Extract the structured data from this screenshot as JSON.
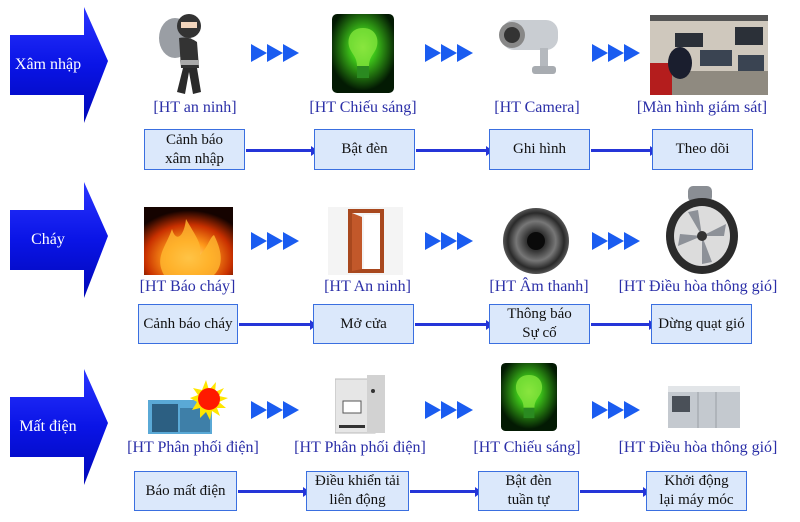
{
  "colors": {
    "trigger_arrow": "#0a14e6",
    "flow_arrow": "#1a5cf0",
    "caption_text": "#2b2fa8",
    "box_fill": "#dbe8fb",
    "box_border": "#3a6fe0",
    "connector": "#2535d8"
  },
  "rows": [
    {
      "trigger": "Xâm nhập",
      "systems": [
        {
          "caption": "[HT an ninh]",
          "icon": "burglar-icon"
        },
        {
          "caption": "[HT Chiếu sáng]",
          "icon": "lightbulb-icon"
        },
        {
          "caption": "[HT Camera]",
          "icon": "cctv-camera-icon"
        },
        {
          "caption": "[Màn hình giám sát]",
          "icon": "monitoring-room-icon"
        }
      ],
      "actions": [
        {
          "line1": "Cảnh báo",
          "line2": "xâm nhập"
        },
        {
          "line1": "Bật đèn",
          "line2": ""
        },
        {
          "line1": "Ghi hình",
          "line2": ""
        },
        {
          "line1": "Theo dõi",
          "line2": ""
        }
      ]
    },
    {
      "trigger": "Cháy",
      "systems": [
        {
          "caption": "[HT Báo cháy]",
          "icon": "fire-icon"
        },
        {
          "caption": "[HT An ninh]",
          "icon": "open-door-icon"
        },
        {
          "caption": "[HT Âm thanh]",
          "icon": "speaker-icon"
        },
        {
          "caption": "[HT Điều hòa thông gió]",
          "icon": "ventilation-fan-icon"
        }
      ],
      "actions": [
        {
          "line1": "Cảnh báo cháy",
          "line2": ""
        },
        {
          "line1": "Mở cửa",
          "line2": ""
        },
        {
          "line1": "Thông báo",
          "line2": "Sự cố"
        },
        {
          "line1": "Dừng quạt gió",
          "line2": ""
        }
      ]
    },
    {
      "trigger": "Mất điện",
      "systems": [
        {
          "caption": "[HT Phân phối điện]",
          "icon": "generator-explosion-icon"
        },
        {
          "caption": "[HT Phân phối điện]",
          "icon": "power-controller-icon"
        },
        {
          "caption": "[HT Chiếu sáng]",
          "icon": "lightbulb-icon"
        },
        {
          "caption": "[HT Điều hòa thông gió]",
          "icon": "air-handling-unit-icon"
        }
      ],
      "actions": [
        {
          "line1": "Báo mất điện",
          "line2": ""
        },
        {
          "line1": "Điều khiển tải",
          "line2": "liên động"
        },
        {
          "line1": "Bật đèn",
          "line2": "tuần tự"
        },
        {
          "line1": "Khởi động",
          "line2": "lại máy móc"
        }
      ]
    }
  ]
}
